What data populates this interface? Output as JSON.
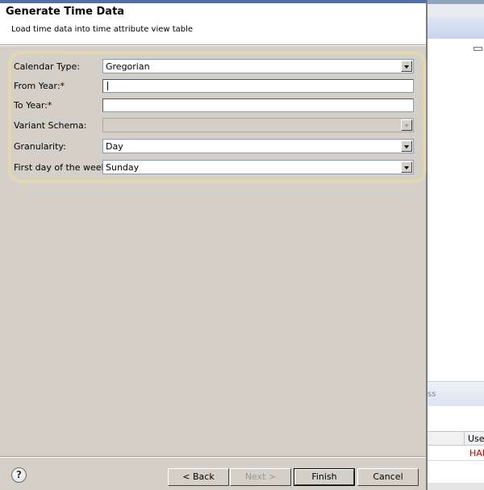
{
  "dialog": {
    "title": "Generate Time Data",
    "description": "Load time data into time attribute view table"
  },
  "form": {
    "calendar_type": {
      "label": "Calendar Type:",
      "value": "Gregorian"
    },
    "from_year": {
      "label": "From Year:*",
      "value": ""
    },
    "to_year": {
      "label": "To Year:*",
      "value": ""
    },
    "variant_schema": {
      "label": "Variant Schema:",
      "value": ""
    },
    "granularity": {
      "label": "Granularity:",
      "value": "Day"
    },
    "first_day": {
      "label": "First day of the week:",
      "value": "Sunday"
    }
  },
  "buttons": {
    "help": "?",
    "back": "< Back",
    "next": "Next >",
    "finish": "Finish",
    "cancel": "Cancel"
  },
  "background": {
    "tab_fragment": "ss",
    "column_header": "Use",
    "cell_value": "HAI"
  },
  "colors": {
    "dialog_bg": "#d4d0c8",
    "highlight_border": "#e8d99a",
    "field_border": "#7f9db9",
    "cell_red": "#c00000"
  }
}
